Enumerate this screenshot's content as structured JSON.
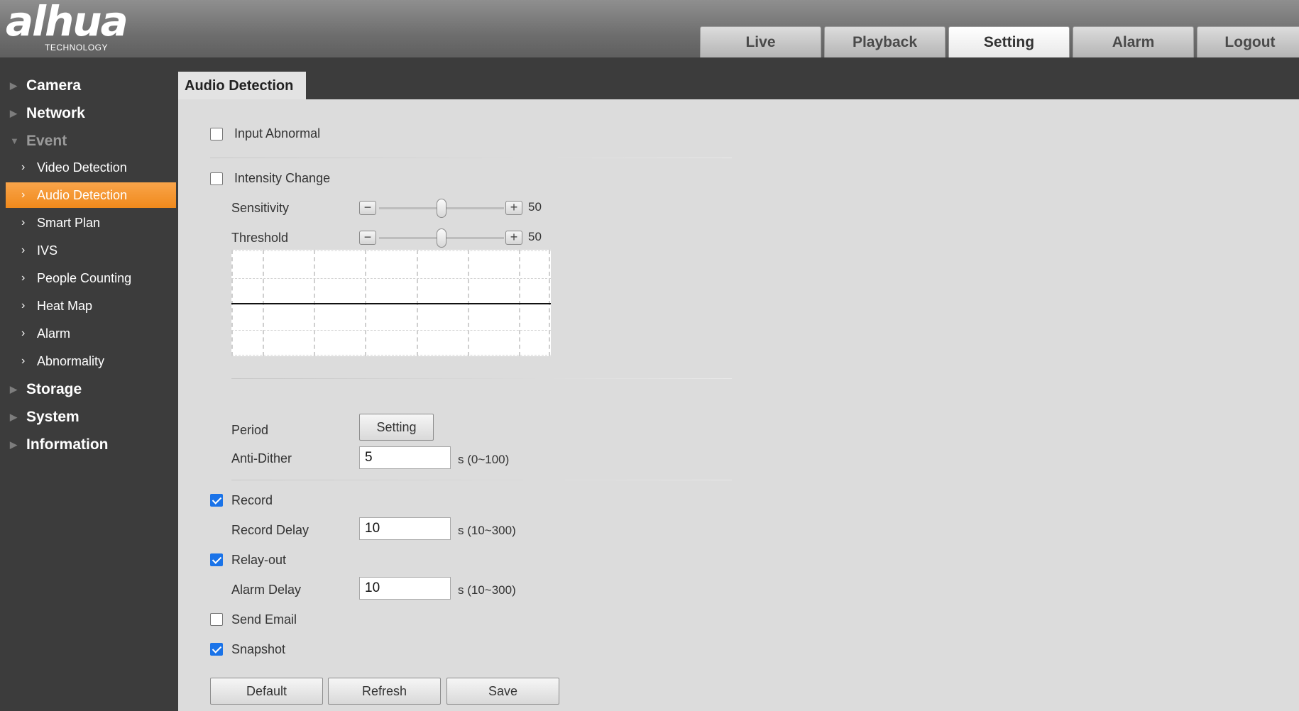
{
  "brand": {
    "logo_text": "alhua",
    "logo_sub": "TECHNOLOGY"
  },
  "topnav": {
    "tabs": [
      {
        "label": "Live",
        "active": false
      },
      {
        "label": "Playback",
        "active": false
      },
      {
        "label": "Setting",
        "active": true
      },
      {
        "label": "Alarm",
        "active": false
      },
      {
        "label": "Logout",
        "active": false
      }
    ]
  },
  "sidebar": {
    "camera": "Camera",
    "network": "Network",
    "event": "Event",
    "items": [
      "Video Detection",
      "Audio Detection",
      "Smart Plan",
      "IVS",
      "People Counting",
      "Heat Map",
      "Alarm",
      "Abnormality"
    ],
    "active_item": "Audio Detection",
    "storage": "Storage",
    "system": "System",
    "information": "Information"
  },
  "page": {
    "title": "Audio Detection"
  },
  "form": {
    "input_abnormal": {
      "label": "Input Abnormal",
      "checked": false
    },
    "intensity_change": {
      "label": "Intensity Change",
      "checked": false
    },
    "sensitivity": {
      "label": "Sensitivity",
      "value": "50"
    },
    "threshold": {
      "label": "Threshold",
      "value": "50"
    },
    "period": {
      "label": "Period",
      "button": "Setting"
    },
    "anti_dither": {
      "label": "Anti-Dither",
      "value": "5",
      "unit": "s (0~100)"
    },
    "record": {
      "label": "Record",
      "checked": true
    },
    "record_delay": {
      "label": "Record Delay",
      "value": "10",
      "unit": "s (10~300)"
    },
    "relay_out": {
      "label": "Relay-out",
      "checked": true
    },
    "alarm_delay": {
      "label": "Alarm Delay",
      "value": "10",
      "unit": "s (10~300)"
    },
    "send_email": {
      "label": "Send Email",
      "checked": false
    },
    "snapshot": {
      "label": "Snapshot",
      "checked": true
    }
  },
  "actions": {
    "default": "Default",
    "refresh": "Refresh",
    "save": "Save"
  },
  "colors": {
    "accent": "#f08a1c",
    "header": "#7a7a7a",
    "panel": "#dcdcdc",
    "sidebar": "#3c3c3c"
  }
}
